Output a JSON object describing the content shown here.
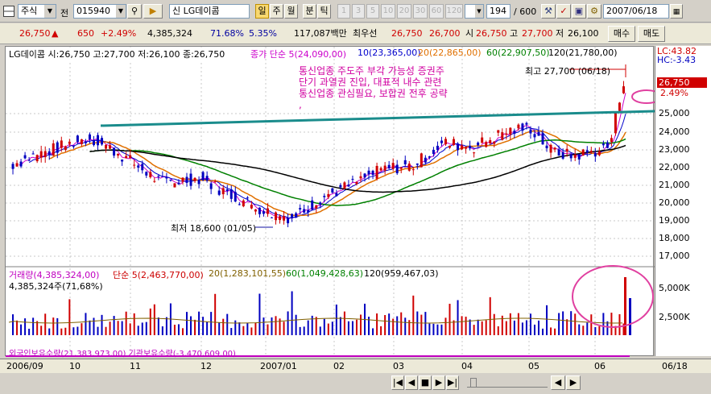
{
  "toolbar": {
    "market_select": "주식",
    "code_label": "전",
    "code_value": "015940",
    "name_value": "신 LG데이콤",
    "period_buttons": [
      "일",
      "주",
      "월",
      "분",
      "틱"
    ],
    "number_buttons": [
      "1",
      "3",
      "5",
      "10",
      "20",
      "30",
      "60",
      "120"
    ],
    "count_value": "194",
    "count_total": "/ 600",
    "date_value": "2007/06/18"
  },
  "quote": {
    "price": "26,750",
    "arrow": "▲",
    "change": "650",
    "change_pct": "+2.49%",
    "volume": "4,385,324",
    "pct1": "71.68%",
    "pct2": "5.35%",
    "amount": "117,087백만",
    "best_label": "최우선",
    "best_ask": "26,750",
    "best_bid": "26,700",
    "open_label": "시",
    "open": "26,750",
    "high_label": "고",
    "high": "27,700",
    "low_label": "저",
    "low": "26,100",
    "buy_button": "매수",
    "sell_button": "매도"
  },
  "price_panel": {
    "header": "LG데이콤 시:26,750 고:27,700 저:26,100 종:26,750",
    "ma_legend": [
      {
        "label": "종가 단순 5(24,090,00)",
        "color": "#cc00cc"
      },
      {
        "label": "10(23,365,00)",
        "color": "#0000cc"
      },
      {
        "label": "20(22,865,00)",
        "color": "#e07000"
      },
      {
        "label": "60(22,907,50)",
        "color": "#008000"
      },
      {
        "label": "120(21,780,00)",
        "color": "#000000"
      }
    ],
    "high_annotation": "최고 27,700 (06/18)",
    "low_annotation": "최저 18,600 (01/05)",
    "comment_lines": [
      "통신업종 주도주 부각 가능성 증권주",
      "단기 과열권 진입, 대표적 내수 관련",
      "통신업종 관심필요, 보합권 전후 공략",
      ","
    ]
  },
  "volume_panel": {
    "header": "거래량(4,385,324,00)",
    "legend": [
      {
        "label": "단순 5(2,463,770,00)",
        "color": "#cc0000"
      },
      {
        "label": "20(1,283,101,55)",
        "color": "#806000"
      },
      {
        "label": "60(1,049,428,63)",
        "color": "#008000"
      },
      {
        "label": "120(959,467,03)",
        "color": "#000000"
      }
    ],
    "sub_header": "4,385,324주(71,68%)",
    "bottom_legend": "외국인보유수량(21,383,973,00)  기관보유수량(-3,470,609,00)"
  },
  "right_axis": {
    "lc": "LC:43.82",
    "hc": "HC:-3.43",
    "price_tag": "26,750",
    "pct_tag": "2.49%",
    "price_ticks": [
      "25,000",
      "24,000",
      "23,000",
      "22,000",
      "21,000",
      "20,000",
      "19,000",
      "18,000",
      "17,000"
    ],
    "volume_ticks": [
      "5,000K",
      "2,500K"
    ]
  },
  "date_axis": {
    "labels": [
      "2006/09",
      "10",
      "11",
      "12",
      "2007/01",
      "02",
      "03",
      "04",
      "05",
      "06",
      "06/18"
    ]
  },
  "chart_data": {
    "type": "candlestick",
    "title": "LG데이콤",
    "x_range": [
      "2006/09",
      "2007/06/18"
    ],
    "ylim": [
      16500,
      27700
    ],
    "last": {
      "open": 26750,
      "high": 27700,
      "low": 26100,
      "close": 26750,
      "volume": 4385324
    },
    "high_point": {
      "date": "06/18",
      "value": 27700
    },
    "low_point": {
      "date": "01/05",
      "value": 18600
    },
    "moving_averages": {
      "ma5": 24090,
      "ma10": 23365,
      "ma20": 22865,
      "ma60": 22907.5,
      "ma120": 21780
    },
    "volume_ma": {
      "ma5": 2463770,
      "ma20": 1283101.55,
      "ma60": 1049428.63,
      "ma120": 959467.03
    }
  }
}
